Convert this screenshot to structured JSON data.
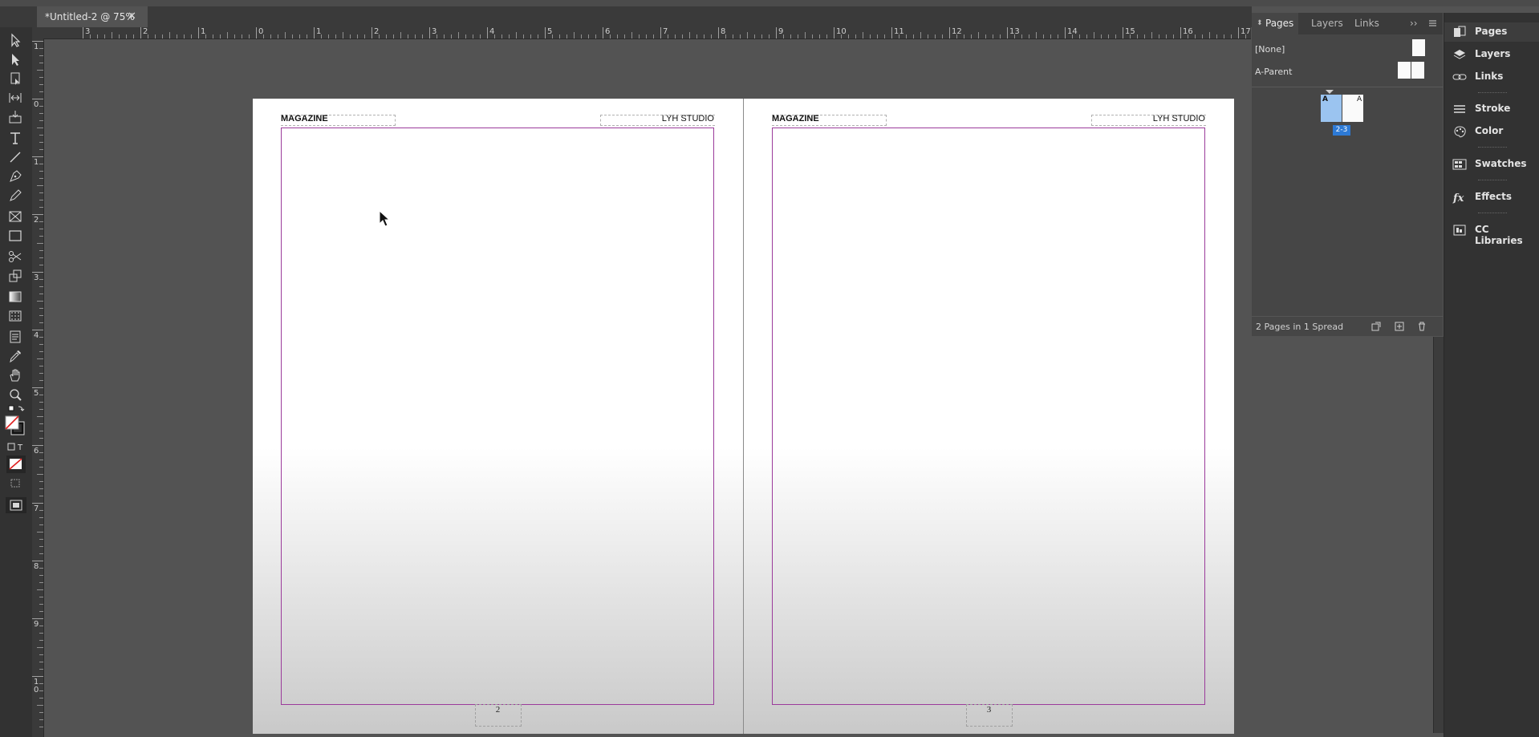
{
  "document": {
    "tab_title": "*Untitled-2 @ 75%",
    "close_glyph": "✕"
  },
  "rulers": {
    "horizontal": [
      "3",
      "2",
      "1",
      "0",
      "1",
      "2",
      "3",
      "4",
      "5",
      "6",
      "7",
      "8",
      "9",
      "10",
      "11",
      "12",
      "13",
      "14",
      "15",
      "16",
      "17"
    ],
    "vertical": [
      "1",
      "0",
      "1",
      "2",
      "3",
      "4",
      "5",
      "6",
      "7",
      "8",
      "9",
      "1\n0"
    ]
  },
  "spread": {
    "left_page": {
      "header_left": "MAGAZINE",
      "header_right": "LYH STUDIO",
      "page_number": "2"
    },
    "right_page": {
      "header_left": "MAGAZINE",
      "header_right": "LYH STUDIO",
      "page_number": "3"
    }
  },
  "pages_panel": {
    "tabs": [
      "Pages",
      "Layers",
      "Links"
    ],
    "parents": [
      "[None]",
      "A-Parent"
    ],
    "spread_label": "2-3",
    "spread_prefix_left": "A",
    "spread_prefix_right": "A",
    "status": "2 Pages in 1 Spread",
    "accent": "#2d7ad6"
  },
  "dock": {
    "items": [
      {
        "label": "Pages",
        "icon": "pages-icon"
      },
      {
        "label": "Layers",
        "icon": "layers-icon"
      },
      {
        "label": "Links",
        "icon": "links-icon"
      },
      {
        "label": "Stroke",
        "icon": "stroke-icon"
      },
      {
        "label": "Color",
        "icon": "color-icon"
      },
      {
        "label": "Swatches",
        "icon": "swatches-icon"
      },
      {
        "label": "Effects",
        "icon": "effects-icon"
      },
      {
        "label": "CC Libraries",
        "icon": "cc-libraries-icon"
      }
    ]
  },
  "tools": [
    "selection-tool",
    "direct-selection-tool",
    "page-tool",
    "gap-tool",
    "content-collector-tool",
    "type-tool",
    "line-tool",
    "pen-tool",
    "pencil-tool",
    "rectangle-frame-tool",
    "rectangle-tool",
    "scissors-tool",
    "free-transform-tool",
    "gradient-swatch-tool",
    "gradient-feather-tool",
    "note-tool",
    "eyedropper-tool",
    "hand-tool",
    "zoom-tool"
  ]
}
